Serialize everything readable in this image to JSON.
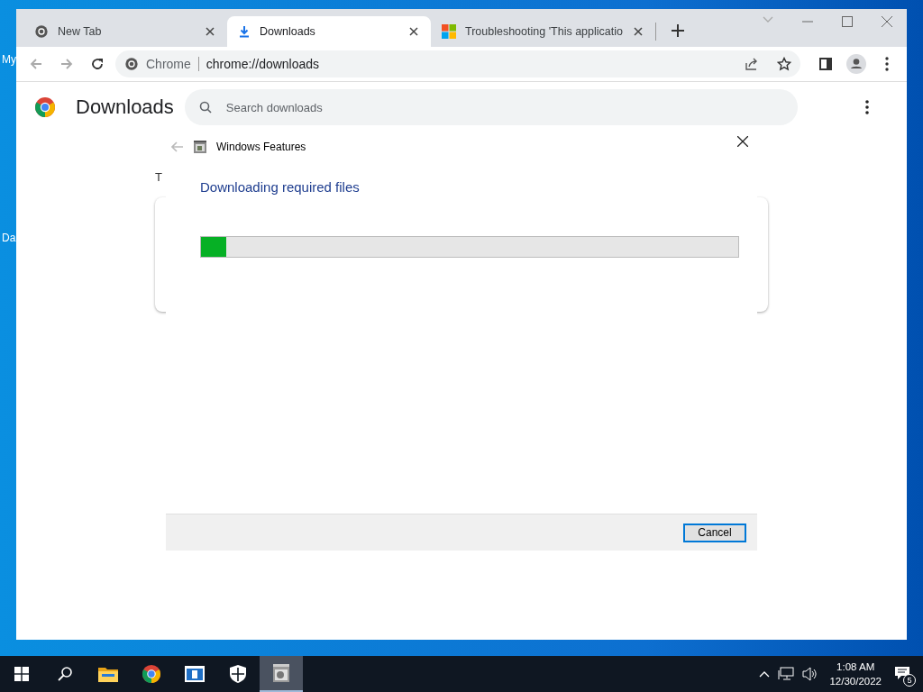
{
  "desktop": {
    "icon_labels": [
      "My",
      "Da"
    ]
  },
  "browser": {
    "tabs": [
      {
        "title": "New Tab",
        "kind": "chrome",
        "selected": false
      },
      {
        "title": "Downloads",
        "kind": "download",
        "selected": true
      },
      {
        "title": "Troubleshooting 'This applicatio",
        "kind": "windows",
        "selected": false
      }
    ],
    "address": {
      "site": "Chrome",
      "url": "chrome://downloads"
    },
    "page": {
      "title": "Downloads",
      "search": {
        "placeholder": "Search downloads"
      },
      "partial_label": "T"
    }
  },
  "dialog": {
    "title": "Windows Features",
    "heading": "Downloading required files",
    "progress": {
      "level": 0.047
    },
    "buttons": [
      {
        "label": "Cancel",
        "default": true
      }
    ]
  },
  "taskbar": {
    "apps": [
      {
        "kind": "start",
        "selected": false
      },
      {
        "kind": "search",
        "selected": false
      },
      {
        "kind": "folder",
        "selected": false
      },
      {
        "kind": "chrome",
        "selected": false
      },
      {
        "kind": "window",
        "selected": false
      },
      {
        "kind": "shield",
        "selected": false
      },
      {
        "kind": "features",
        "selected": true
      }
    ],
    "time": "1:08 AM",
    "date": "12/30/2022",
    "notifications": "5"
  }
}
